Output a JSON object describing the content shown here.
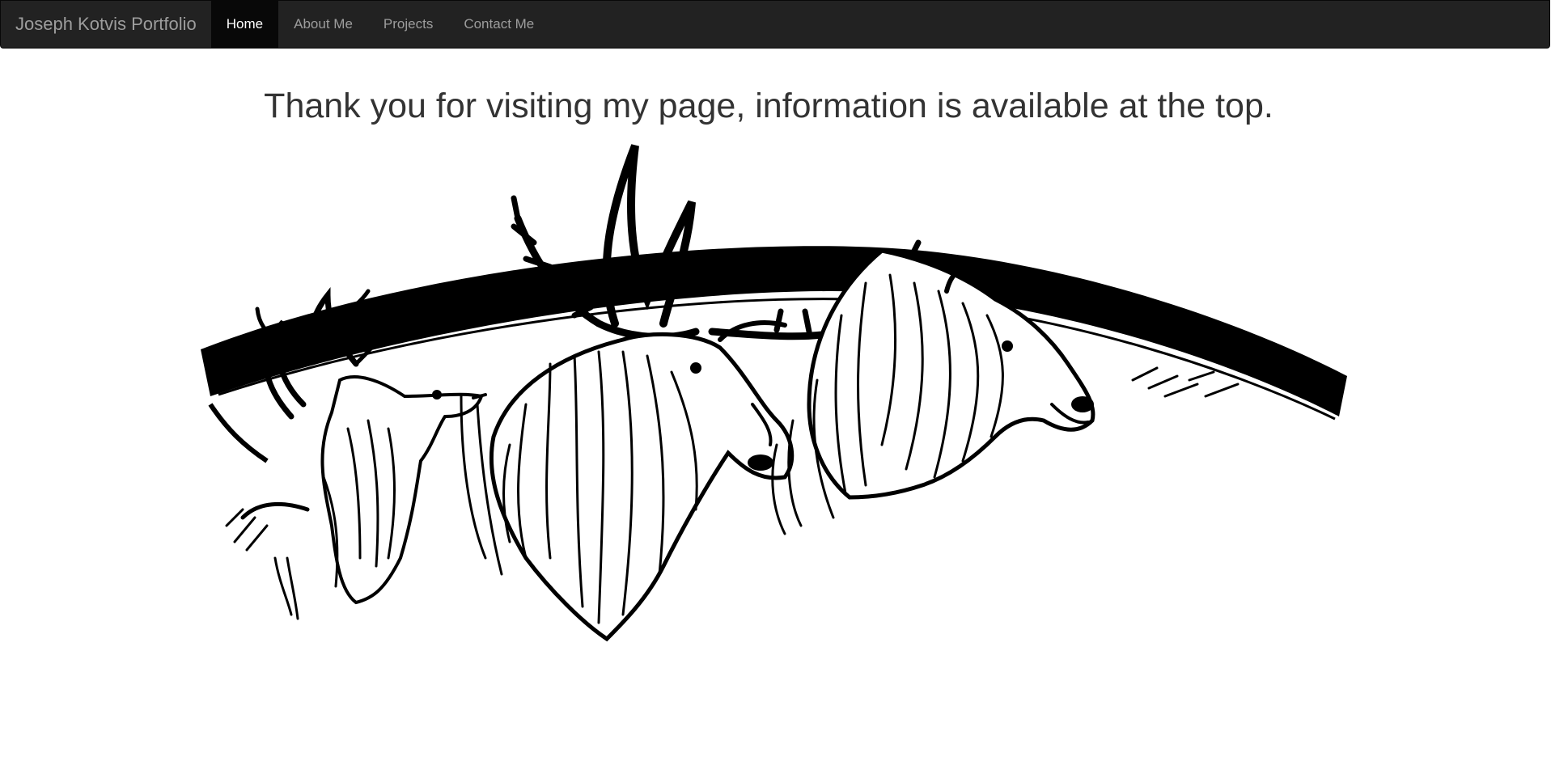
{
  "navbar": {
    "brand": "Joseph Kotvis Portfolio",
    "items": [
      {
        "label": "Home",
        "active": true
      },
      {
        "label": "About Me",
        "active": false
      },
      {
        "label": "Projects",
        "active": false
      },
      {
        "label": "Contact Me",
        "active": false
      }
    ]
  },
  "main": {
    "headline": "Thank you for visiting my page, information is available at the top."
  },
  "colors": {
    "navbar_bg": "#222222",
    "nav_active_bg": "#080808",
    "nav_text": "#9d9d9d",
    "nav_active_text": "#ffffff",
    "headline_text": "#333333"
  }
}
